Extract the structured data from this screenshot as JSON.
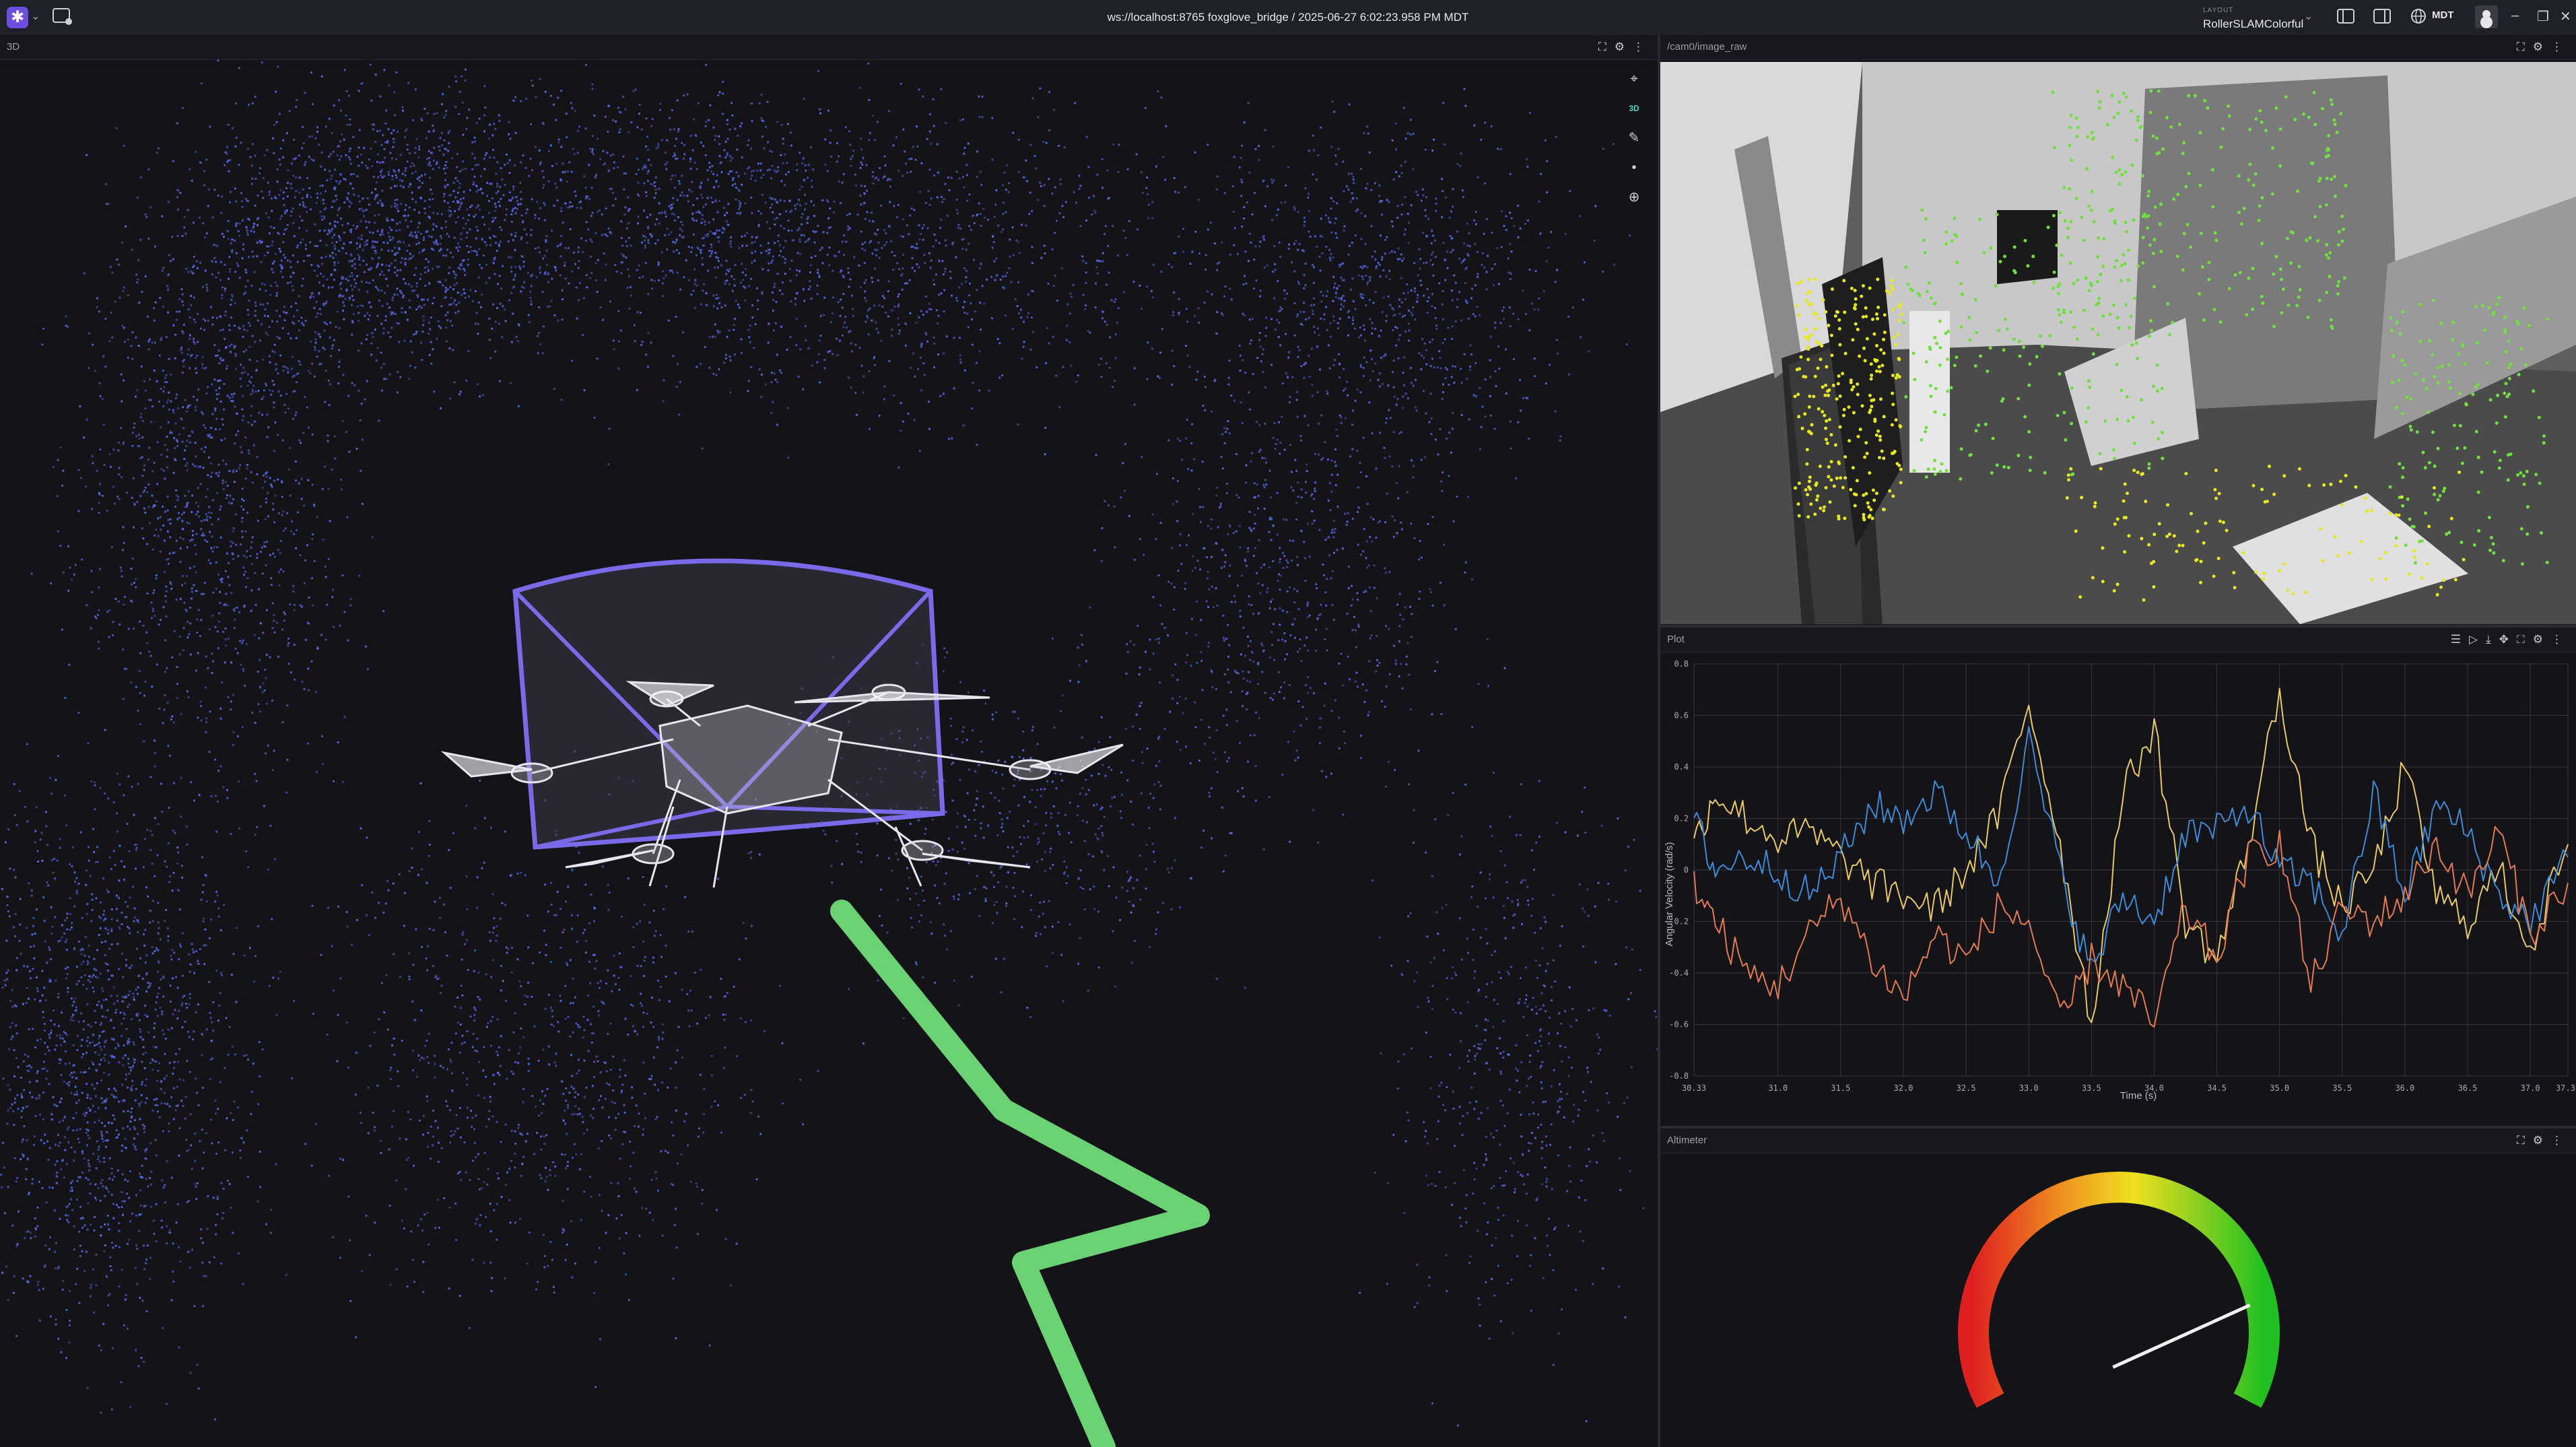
{
  "topbar": {
    "connection": "ws://localhost:8765 foxglove_bridge / 2025-06-27 6:02:23.958 PM MDT",
    "layout_label": "LAYOUT",
    "layout_name": "RollerSLAMColorful",
    "timezone": "MDT"
  },
  "panels": {
    "three_d": {
      "title": "3D",
      "mode_badge": "3D"
    },
    "image": {
      "title": "/cam0/image_raw"
    },
    "plot": {
      "title": "Plot"
    },
    "altimeter": {
      "title": "Altimeter"
    }
  },
  "icons": {
    "app_menu": "foxglove-logo-icon",
    "new_window": "new-window-icon",
    "left_sidebar": "left-sidebar-icon",
    "right_sidebar": "right-sidebar-icon",
    "timezone": "globe-icon",
    "user": "user-icon",
    "fullscreen": "fullscreen-icon",
    "settings": "gear-icon",
    "more": "more-vertical-icon",
    "select": "cursor-icon",
    "measure": "ruler-icon",
    "publish": "publish-point-icon",
    "follow": "crosshair-icon"
  },
  "colors": {
    "point_cloud": "#5a68e6",
    "trajectory": "#6fdc7a",
    "camera_frustum": "#7a6ae8",
    "series_x": "#e8c86a",
    "series_y": "#3f8ad4",
    "series_z": "#e07a52",
    "accent": "#6c4ee0"
  },
  "chart_data": {
    "type": "line",
    "title": "",
    "xlabel": "Time (s)",
    "ylabel": "Angular Velocity (rad/s)",
    "xlim": [
      30.33,
      37.3
    ],
    "ylim": [
      -0.8,
      0.8
    ],
    "x_ticks": [
      "30.33",
      "31.0",
      "31.5",
      "32.0",
      "32.5",
      "33.0",
      "33.5",
      "34.0",
      "34.5",
      "35.0",
      "35.5",
      "36.0",
      "36.5",
      "37.0",
      "37.30"
    ],
    "y_ticks": [
      "0.8",
      "0.6",
      "0.4",
      "0.2",
      "0",
      "-0.2",
      "-0.4",
      "-0.6",
      "-0.8"
    ],
    "x": [
      30.33,
      30.5,
      30.75,
      31.0,
      31.25,
      31.5,
      31.75,
      32.0,
      32.25,
      32.5,
      32.75,
      33.0,
      33.25,
      33.5,
      33.75,
      34.0,
      34.25,
      34.5,
      34.75,
      35.0,
      35.25,
      35.5,
      35.75,
      36.0,
      36.25,
      36.5,
      36.75,
      37.0,
      37.3
    ],
    "series": [
      {
        "color": "#e8c86a",
        "values": [
          0.1,
          0.3,
          0.2,
          0.12,
          0.15,
          0.05,
          -0.05,
          -0.1,
          -0.15,
          0.0,
          0.2,
          0.65,
          0.1,
          -0.6,
          0.3,
          0.55,
          -0.2,
          -0.35,
          0.1,
          0.7,
          0.1,
          -0.15,
          0.0,
          0.4,
          -0.1,
          -0.2,
          0.0,
          -0.3,
          0.1
        ]
      },
      {
        "color": "#3f8ad4",
        "values": [
          0.2,
          0.0,
          0.05,
          0.0,
          -0.1,
          0.05,
          0.25,
          0.2,
          0.3,
          0.15,
          -0.05,
          0.5,
          0.0,
          -0.4,
          -0.1,
          -0.2,
          0.15,
          0.15,
          0.25,
          0.0,
          -0.05,
          -0.25,
          0.3,
          -0.1,
          0.25,
          0.15,
          -0.1,
          -0.2,
          0.05
        ]
      },
      {
        "color": "#e07a52",
        "values": [
          -0.05,
          -0.2,
          -0.4,
          -0.45,
          -0.25,
          -0.1,
          -0.35,
          -0.5,
          -0.25,
          -0.35,
          -0.15,
          -0.2,
          -0.6,
          -0.35,
          -0.45,
          -0.6,
          -0.15,
          -0.35,
          0.05,
          0.1,
          -0.45,
          -0.15,
          -0.2,
          -0.1,
          0.1,
          -0.1,
          0.15,
          -0.25,
          -0.05
        ]
      }
    ]
  },
  "altimeter": {
    "value_fraction": 0.78
  }
}
